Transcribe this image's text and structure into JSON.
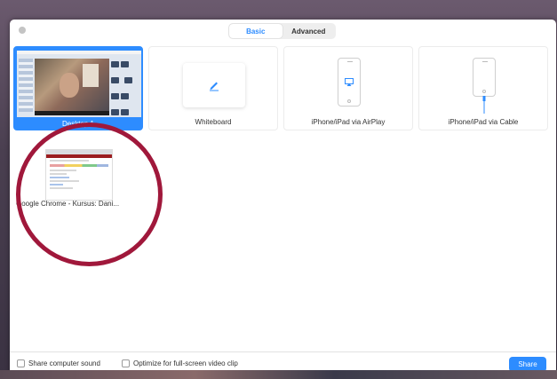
{
  "tabs": [
    {
      "label": "Basic",
      "active": true
    },
    {
      "label": "Advanced",
      "active": false
    }
  ],
  "sources": [
    {
      "label": "Desktop 1",
      "selected": true,
      "kind": "desktop"
    },
    {
      "label": "Whiteboard",
      "selected": false,
      "kind": "whiteboard",
      "icon": "pencil-icon"
    },
    {
      "label": "iPhone/iPad via AirPlay",
      "selected": false,
      "kind": "airplay",
      "icon": "airplay-icon"
    },
    {
      "label": "iPhone/iPad via Cable",
      "selected": false,
      "kind": "cable",
      "icon": "cable-icon"
    },
    {
      "label": "Google Chrome - Kursus: Dani...",
      "selected": false,
      "kind": "window"
    }
  ],
  "footer": {
    "share_sound_label": "Share computer sound",
    "optimize_label": "Optimize for full-screen video clip",
    "share_button": "Share"
  },
  "colors": {
    "accent": "#2d8cff",
    "annotation": "#a0183b"
  }
}
